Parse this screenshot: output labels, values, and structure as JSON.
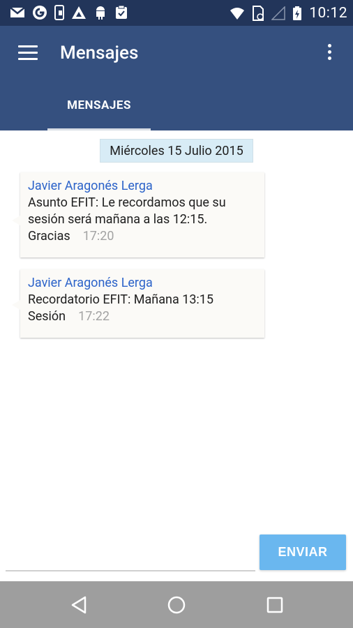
{
  "status_bar": {
    "time": "10:12",
    "left_icons": [
      "gmail-icon",
      "google-icon",
      "phone-icon",
      "mountain-icon",
      "android-icon",
      "clipboard-icon"
    ],
    "right_icons": [
      "wifi-icon",
      "sim-icon",
      "signal-icon",
      "battery-charging-icon"
    ]
  },
  "app_bar": {
    "title": "Mensajes",
    "color": "#35507f"
  },
  "tabs": [
    {
      "label": "MENSAJES",
      "selected": true
    }
  ],
  "date_separator": "Miércoles 15 Julio 2015",
  "messages": [
    {
      "sender": "Javier Aragonés Lerga",
      "text_lines": [
        "Asunto EFIT: Le recordamos que su",
        "sesión será mañana a las 12:15.",
        "Gracias"
      ],
      "time": "17:20"
    },
    {
      "sender": "Javier Aragonés Lerga",
      "text_lines": [
        "Recordatorio EFIT: Mañana 13:15",
        "Sesión"
      ],
      "time": "17:22"
    }
  ],
  "compose": {
    "value": "",
    "send_label": "ENVIAR",
    "send_color": "#6ab7ef"
  },
  "nav_bar": {
    "buttons": [
      "back-icon",
      "home-icon",
      "recents-icon"
    ]
  }
}
